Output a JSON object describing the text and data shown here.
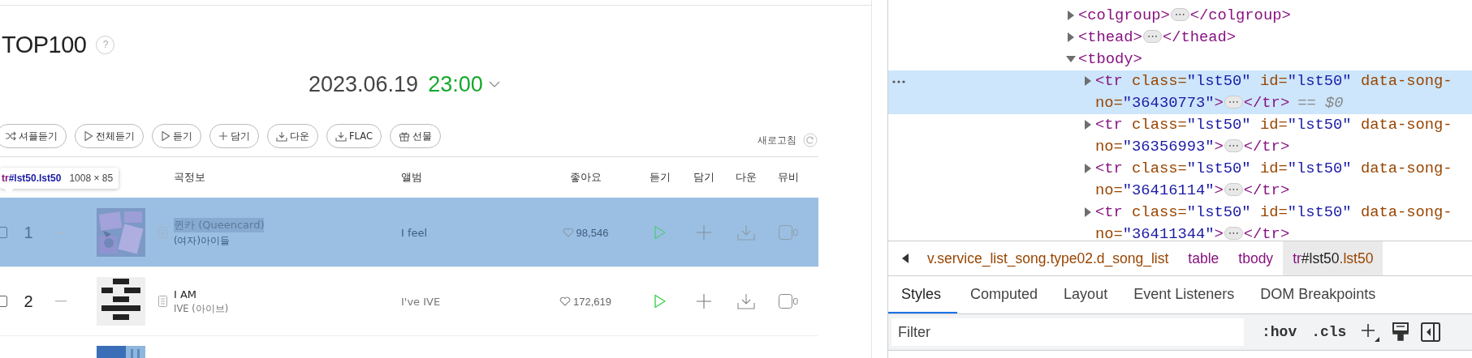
{
  "page": {
    "title": "TOP100",
    "help": "?",
    "date": "2023.06.19",
    "time": "23:00",
    "actions": [
      {
        "kind": "shuffle",
        "label": "셔플듣기"
      },
      {
        "kind": "play",
        "label": "전체듣기"
      },
      {
        "kind": "play",
        "label": "듣기"
      },
      {
        "kind": "add",
        "label": "담기"
      },
      {
        "kind": "download",
        "label": "다운"
      },
      {
        "kind": "download",
        "label": "FLAC"
      },
      {
        "kind": "gift",
        "label": "선물"
      }
    ],
    "refresh": "새로고침",
    "columns": [
      "곡정보",
      "앨범",
      "좋아요",
      "듣기",
      "담기",
      "다운",
      "뮤비"
    ],
    "rows": [
      {
        "selected": true,
        "checked": false,
        "rank": "1",
        "title": "퀸카 (Queencard)",
        "artist": "(여자)아이들",
        "album": "I feel",
        "likes": "98,546"
      },
      {
        "selected": false,
        "checked": false,
        "rank": "2",
        "title": "I AM",
        "artist": "IVE (아이브)",
        "album": "I've IVE",
        "likes": "172,619"
      },
      {
        "selected": false
      }
    ],
    "inspect_tooltip": {
      "tag": "tr",
      "selector": "#lst50.lst50",
      "size": "1008 × 85"
    }
  },
  "devtools": {
    "tree": [
      {
        "expanded": false,
        "selected": false,
        "open": [
          {
            "kind": "tag",
            "text": "<colgroup>"
          }
        ],
        "ellipsis": "⋯",
        "close": "</colgroup>"
      },
      {
        "expanded": false,
        "selected": false,
        "open": [
          {
            "kind": "tag",
            "text": "<thead>"
          }
        ],
        "ellipsis": "⋯",
        "close": "</thead>"
      },
      {
        "expanded": true,
        "selected": false,
        "open": [
          {
            "kind": "tag",
            "text": "<tbody>"
          }
        ],
        "children": [
          {
            "expanded": false,
            "selected": true,
            "open": [
              {
                "kind": "tag",
                "text": "<tr"
              },
              {
                "kind": "attr",
                "text": "class="
              },
              {
                "kind": "value",
                "text": "\"lst50\""
              },
              {
                "kind": "attr",
                "text": "id="
              },
              {
                "kind": "value",
                "text": "\"lst50\""
              },
              {
                "kind": "attr",
                "text": "data-song-no="
              },
              {
                "kind": "value",
                "text": "\"36430773\""
              },
              {
                "kind": "tag",
                "text": ">"
              }
            ],
            "ellipsis": "⋯",
            "close": "</tr>",
            "marker": "== $0"
          },
          {
            "expanded": false,
            "selected": false,
            "open": [
              {
                "kind": "tag",
                "text": "<tr"
              },
              {
                "kind": "attr",
                "text": "class="
              },
              {
                "kind": "value",
                "text": "\"lst50\""
              },
              {
                "kind": "attr",
                "text": "id="
              },
              {
                "kind": "value",
                "text": "\"lst50\""
              },
              {
                "kind": "attr",
                "text": "data-song-no="
              },
              {
                "kind": "value",
                "text": "\"36356993\""
              },
              {
                "kind": "tag",
                "text": ">"
              }
            ],
            "ellipsis": "⋯",
            "close": "</tr>"
          },
          {
            "expanded": false,
            "selected": false,
            "open": [
              {
                "kind": "tag",
                "text": "<tr"
              },
              {
                "kind": "attr",
                "text": "class="
              },
              {
                "kind": "value",
                "text": "\"lst50\""
              },
              {
                "kind": "attr",
                "text": "id="
              },
              {
                "kind": "value",
                "text": "\"lst50\""
              },
              {
                "kind": "attr",
                "text": "data-song-no="
              },
              {
                "kind": "value",
                "text": "\"36416114\""
              },
              {
                "kind": "tag",
                "text": ">"
              }
            ],
            "ellipsis": "⋯",
            "close": "</tr>"
          },
          {
            "expanded": false,
            "selected": false,
            "open": [
              {
                "kind": "tag",
                "text": "<tr"
              },
              {
                "kind": "attr",
                "text": "class="
              },
              {
                "kind": "value",
                "text": "\"lst50\""
              },
              {
                "kind": "attr",
                "text": "id="
              },
              {
                "kind": "value",
                "text": "\"lst50\""
              },
              {
                "kind": "attr",
                "text": "data-song-no="
              },
              {
                "kind": "value",
                "text": "\"36411344\""
              },
              {
                "kind": "tag",
                "text": ">"
              }
            ],
            "ellipsis": "⋯",
            "close": "</tr>"
          }
        ]
      }
    ],
    "breadcrumbs": [
      {
        "selected": false,
        "parts": [
          {
            "kind": "class",
            "text": "v.service_list_song.type02.d_song_list"
          }
        ]
      },
      {
        "selected": false,
        "parts": [
          {
            "kind": "tag",
            "text": "table"
          }
        ]
      },
      {
        "selected": false,
        "parts": [
          {
            "kind": "tag",
            "text": "tbody"
          }
        ]
      },
      {
        "selected": true,
        "parts": [
          {
            "kind": "tag",
            "text": "tr"
          },
          {
            "kind": "id",
            "text": "#lst50"
          },
          {
            "kind": "class",
            "text": ".lst50"
          }
        ]
      }
    ],
    "tabs": [
      {
        "label": "Styles",
        "selected": true
      },
      {
        "label": "Computed",
        "selected": false
      },
      {
        "label": "Layout",
        "selected": false
      },
      {
        "label": "Event Listeners",
        "selected": false
      },
      {
        "label": "DOM Breakpoints",
        "selected": false
      }
    ],
    "filter": {
      "placeholder": "Filter"
    },
    "toggles": [
      ":hov",
      ".cls"
    ]
  }
}
